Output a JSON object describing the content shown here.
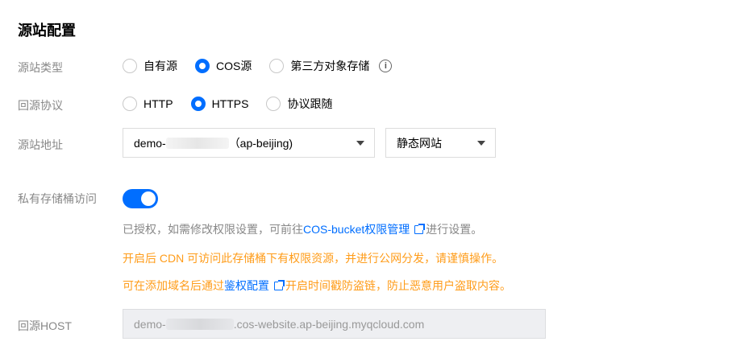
{
  "section": {
    "title": "源站配置"
  },
  "origin_type": {
    "label": "源站类型",
    "options": [
      {
        "label": "自有源",
        "selected": false
      },
      {
        "label": "COS源",
        "selected": true
      },
      {
        "label": "第三方对象存储",
        "selected": false
      }
    ],
    "info_icon": "info-icon"
  },
  "origin_protocol": {
    "label": "回源协议",
    "options": [
      {
        "label": "HTTP",
        "selected": false
      },
      {
        "label": "HTTPS",
        "selected": true
      },
      {
        "label": "协议跟随",
        "selected": false
      }
    ]
  },
  "origin_address": {
    "label": "源站地址",
    "bucket_prefix": "demo-",
    "bucket_region": "（ap-beijing)",
    "site_type": "静态网站"
  },
  "private_bucket": {
    "label": "私有存储桶访问",
    "enabled": true,
    "note_prefix": "已授权，如需修改权限设置，可前往",
    "note_link": "COS-bucket权限管理",
    "note_suffix": "进行设置。",
    "warning": "开启后 CDN 可访问此存储桶下有权限资源，并进行公网分发，请谨慎操作。",
    "tip_prefix": "可在添加域名后通过",
    "tip_link": "鉴权配置",
    "tip_suffix": "开启时间戳防盗链，防止恶意用户盗取内容。"
  },
  "origin_host": {
    "label": "回源HOST",
    "value_prefix": "demo-",
    "value_suffix": ".cos-website.ap-beijing.myqcloud.com"
  },
  "colors": {
    "accent": "#006eff",
    "warning": "#ff9c19",
    "label": "#888888"
  }
}
